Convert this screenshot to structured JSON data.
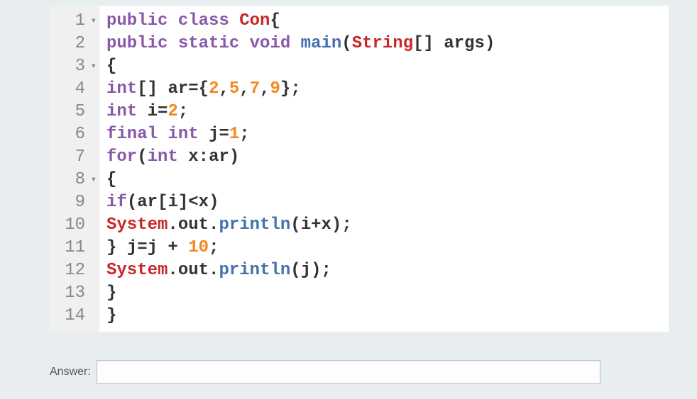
{
  "code": {
    "lines": [
      {
        "num": "1",
        "fold": true
      },
      {
        "num": "2",
        "fold": false
      },
      {
        "num": "3",
        "fold": true
      },
      {
        "num": "4",
        "fold": false
      },
      {
        "num": "5",
        "fold": false
      },
      {
        "num": "6",
        "fold": false
      },
      {
        "num": "7",
        "fold": false
      },
      {
        "num": "8",
        "fold": true
      },
      {
        "num": "9",
        "fold": false
      },
      {
        "num": "10",
        "fold": false
      },
      {
        "num": "11",
        "fold": false
      },
      {
        "num": "12",
        "fold": false
      },
      {
        "num": "13",
        "fold": false
      },
      {
        "num": "14",
        "fold": false
      }
    ],
    "tokens": {
      "l1": {
        "public": "public",
        "class": "class",
        "Con": "Con",
        "brace": "{"
      },
      "l2": {
        "public": "public",
        "static": "static",
        "void": "void",
        "main": "main",
        "open": "(",
        "String": "String",
        "brackets": "[] ",
        "args": "args",
        "close": ")"
      },
      "l3": {
        "brace": "{"
      },
      "l4": {
        "int": "int",
        "brackets": "[] ",
        "ar": "ar",
        "eq": "=",
        "open": "{",
        "n1": "2",
        "c1": ",",
        "n2": "5",
        "c2": ",",
        "n3": "7",
        "c3": ",",
        "n4": "9",
        "close": "}",
        "semi": ";"
      },
      "l5": {
        "int": "int",
        "i": "i",
        "eq": "=",
        "val": "2",
        "semi": ";"
      },
      "l6": {
        "final": "final",
        "int": "int",
        "j": "j",
        "eq": "=",
        "val": "1",
        "semi": ";"
      },
      "l7": {
        "for": "for",
        "open": "(",
        "int": "int",
        "x": "x",
        "colon": ":",
        "ar": "ar",
        "close": ")"
      },
      "l8": {
        "brace": "{"
      },
      "l9": {
        "if": "if",
        "open": "(",
        "ar": "ar",
        "bopen": "[",
        "i": "i",
        "bclose": "]",
        "lt": "<",
        "x": "x",
        "close": ")"
      },
      "l10": {
        "System": "System",
        "d1": ".",
        "out": "out",
        "d2": ".",
        "println": "println",
        "open": "(",
        "i": "i",
        "plus": "+",
        "x": "x",
        "close": ")",
        "semi": ";"
      },
      "l11": {
        "brace": "}",
        "sp": " ",
        "j": "j",
        "eq": "=",
        "j2": "j",
        "plus": " + ",
        "val": "10",
        "semi": ";"
      },
      "l12": {
        "System": "System",
        "d1": ".",
        "out": "out",
        "d2": ".",
        "println": "println",
        "open": "(",
        "j": "j",
        "close": ")",
        "semi": ";"
      },
      "l13": {
        "brace": "}"
      },
      "l14": {
        "brace": "}"
      }
    }
  },
  "answer": {
    "label": "Answer:",
    "value": ""
  },
  "foldGlyph": "▾"
}
